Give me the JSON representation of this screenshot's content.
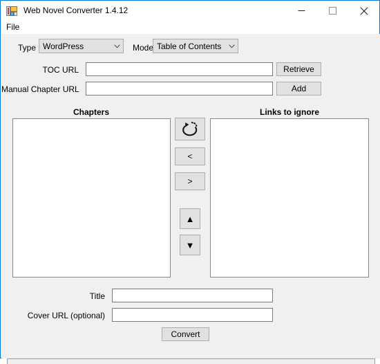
{
  "window": {
    "title": "Web Novel Converter 1.4.12",
    "icon": "app-icon",
    "accent_color": "#0078d7",
    "background_color": "#f0f0f0",
    "titlebar_background": "#ffffff",
    "buttons": {
      "minimize": "minimize-icon",
      "maximize": "maximize-icon",
      "close": "close-icon"
    }
  },
  "menubar": {
    "items": [
      {
        "label": "File"
      }
    ]
  },
  "options_row": {
    "type_label": "Type",
    "type_value": "WordPress",
    "mode_label": "Mode",
    "mode_value": "Table of Contents"
  },
  "url_rows": {
    "toc_label": "TOC URL",
    "toc_value": "",
    "toc_placeholder": "",
    "retrieve_label": "Retrieve",
    "manual_label": "Manual Chapter URL",
    "manual_value": "",
    "manual_placeholder": "",
    "add_label": "Add"
  },
  "lists": {
    "chapters_header": "Chapters",
    "chapters_items": [],
    "ignore_header": "Links to ignore",
    "ignore_items": []
  },
  "transfer_buttons": {
    "refresh": "refresh-circular-arrow-icon",
    "move_left": "<",
    "move_right": ">",
    "move_up": "▲",
    "move_down": "▼"
  },
  "meta_rows": {
    "title_label": "Title",
    "title_value": "",
    "title_placeholder": "",
    "cover_label": "Cover URL (optional)",
    "cover_value": "",
    "cover_placeholder": ""
  },
  "actions": {
    "convert_label": "Convert"
  }
}
